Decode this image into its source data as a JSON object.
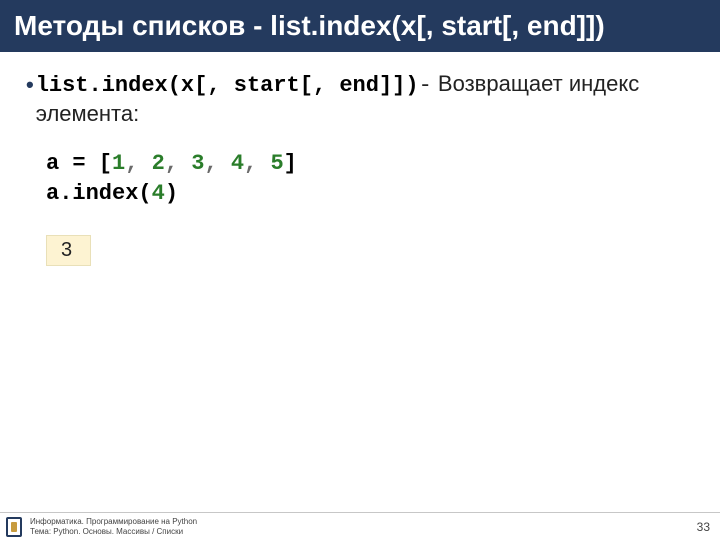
{
  "header": {
    "title": "Методы списков - list.index(x[, start[, end]])"
  },
  "body": {
    "signature": "list.index(x[, start[, end]])",
    "dash": "-",
    "description": "Возвращает индекс элемента:",
    "code": {
      "line1_prefix": "a = [",
      "nums": [
        "1",
        "2",
        "3",
        "4",
        "5"
      ],
      "sep": ", ",
      "line1_suffix": "]",
      "line2_pre": "a.index(",
      "line2_arg": "4",
      "line2_post": ")"
    },
    "output": "3"
  },
  "footer": {
    "line1": "Информатика. Программирование на Python",
    "line2": "Тема: Python. Основы. Массивы / Списки",
    "page": "33"
  }
}
